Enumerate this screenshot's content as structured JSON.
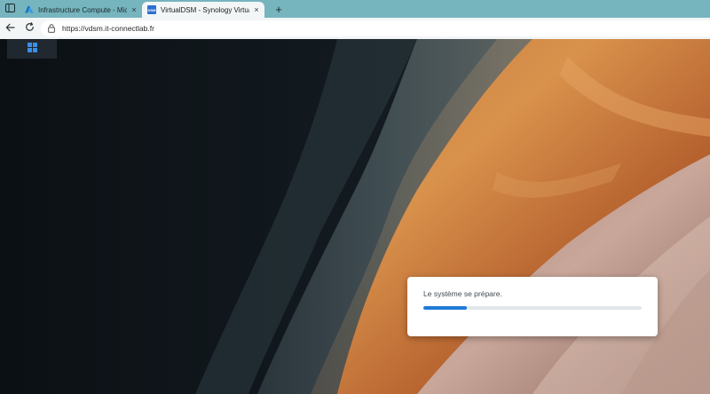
{
  "browser": {
    "tabs": [
      {
        "title": "Infrastructure Compute - Microso",
        "icon": "azure-icon",
        "active": false
      },
      {
        "title": "VirtualDSM - Synology VirtualDSM",
        "icon": "dsm-icon",
        "favicon_text": "DSM",
        "active": true
      }
    ],
    "new_tab_glyph": "+",
    "close_glyph": "×",
    "url": "https://vdsm.it-connectlab.fr"
  },
  "dsm": {
    "menu_icon": "grid-menu-icon",
    "loader": {
      "message": "Le système se prépare.",
      "progress": 0.2
    }
  },
  "colors": {
    "tabbar": "#76b4be",
    "accent": "#1f7ad6"
  }
}
